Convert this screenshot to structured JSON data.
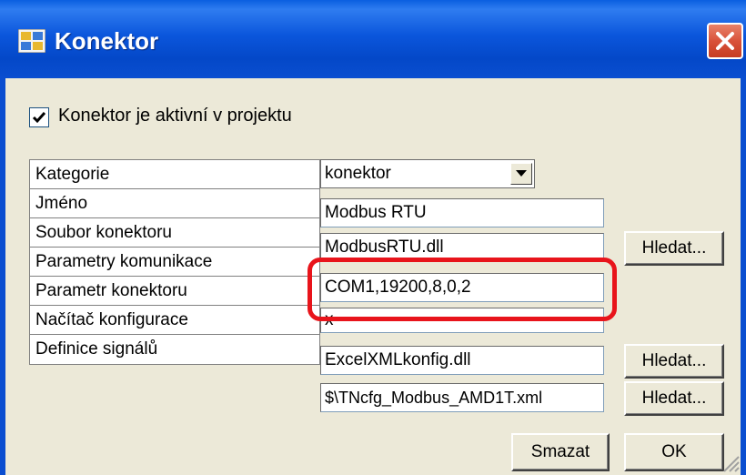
{
  "window": {
    "title": "Konektor",
    "close_icon": "close-icon"
  },
  "active_checkbox": {
    "label": "Konektor je aktivní v projektu",
    "checked": true
  },
  "properties": [
    {
      "label": "Kategorie",
      "value": "konektor"
    },
    {
      "label": "Jméno",
      "value": "Modbus RTU"
    },
    {
      "label": "Soubor konektoru",
      "value": "ModbusRTU.dll"
    },
    {
      "label": "Parametry komunikace",
      "value": "COM1,19200,8,0,2"
    },
    {
      "label": "Parametr konektoru",
      "value": "x"
    },
    {
      "label": "Načítač konfigurace",
      "value": "ExcelXMLkonfig.dll"
    },
    {
      "label": "Definice signálů",
      "value": "$\\TNcfg_Modbus_AMD1T.xml"
    }
  ],
  "buttons": {
    "browse_1": "Hledat...",
    "browse_2": "Hledat...",
    "browse_3": "Hledat...",
    "delete": "Smazat",
    "ok": "OK"
  },
  "colors": {
    "title_bar": "#0a4ed0",
    "dialog_bg": "#ece9d8",
    "highlight": "#e8141b"
  }
}
